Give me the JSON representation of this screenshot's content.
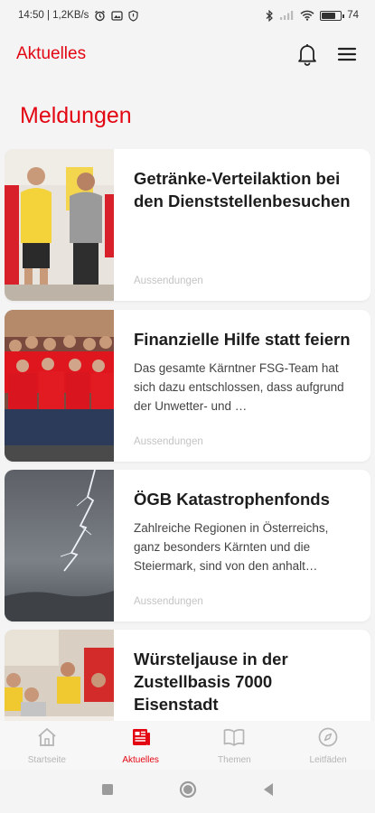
{
  "status_bar": {
    "time_info": "14:50 | 1,2KB/s",
    "battery_text": "74",
    "battery_level": 0.74
  },
  "header": {
    "title": "Aktuelles",
    "icons": [
      "bell-icon",
      "menu-icon"
    ]
  },
  "section": {
    "title": "Meldungen"
  },
  "news": [
    {
      "title": "Getränke-Verteilaktion bei den Dienststellenbesuchen",
      "excerpt": "",
      "category": "Aussendungen"
    },
    {
      "title": "Finanzielle Hilfe statt feiern",
      "excerpt": "Das gesamte Kärntner FSG-Team hat sich dazu entschlossen, dass aufgrund der Unwetter- und …",
      "category": "Aussendungen"
    },
    {
      "title": "ÖGB Katastrophenfonds",
      "excerpt": "Zahlreiche Regionen in Österreichs, ganz besonders Kärnten und die Steiermark, sind von den anhalt…",
      "category": "Aussendungen"
    },
    {
      "title": "Würsteljause in der Zustellbasis 7000 Eisenstadt",
      "excerpt": "",
      "category": ""
    }
  ],
  "bottom_nav": [
    {
      "label": "Startseite",
      "icon": "home-icon",
      "active": false
    },
    {
      "label": "Aktuelles",
      "icon": "news-icon",
      "active": true
    },
    {
      "label": "Themen",
      "icon": "book-icon",
      "active": false
    },
    {
      "label": "Leitfäden",
      "icon": "compass-icon",
      "active": false
    }
  ],
  "colors": {
    "accent": "#e30613",
    "inactive": "#b5b5b5",
    "background": "#f4f4f4"
  }
}
